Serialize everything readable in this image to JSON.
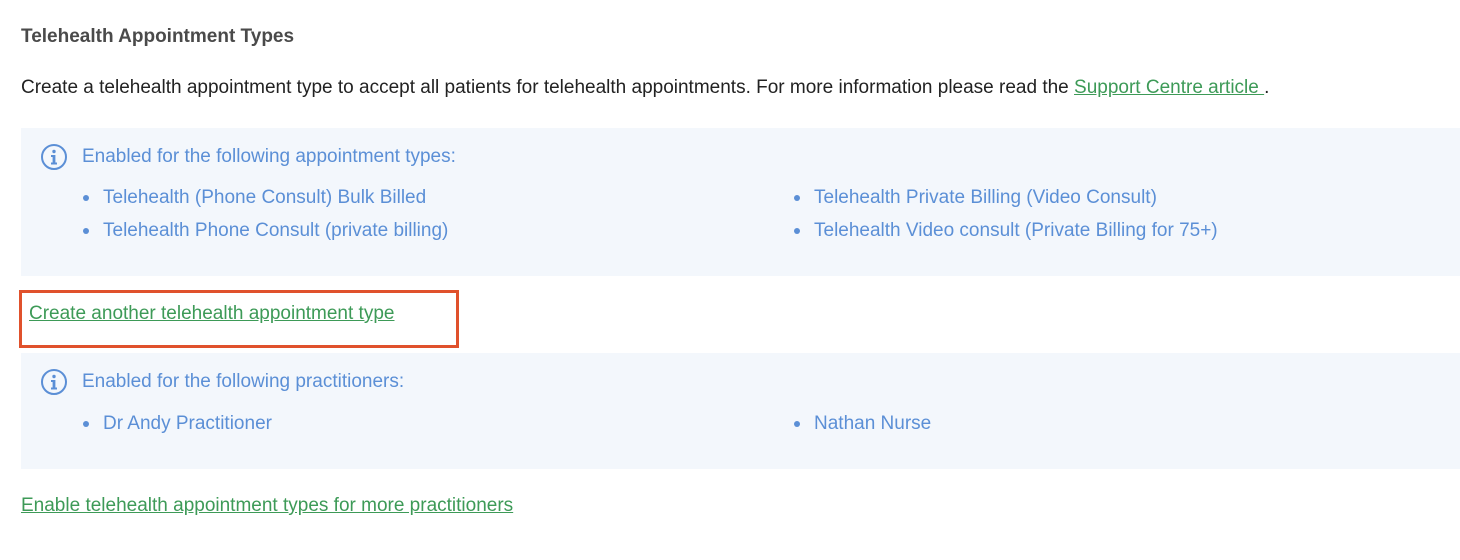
{
  "section": {
    "title": "Telehealth Appointment Types",
    "intro_text": "Create a telehealth appointment type to accept all patients for telehealth appointments. For more information please read the",
    "intro_link": "Support Centre article ",
    "intro_end": "."
  },
  "appointment_types_panel": {
    "icon": "info-icon",
    "heading": "Enabled for the following appointment types:",
    "items": [
      "Telehealth (Phone Consult) Bulk Billed",
      "Telehealth Phone Consult (private billing)",
      "Telehealth Private Billing (Video Consult)",
      "Telehealth Video consult (Private Billing for 75+)"
    ]
  },
  "create_link": "Create another telehealth appointment type",
  "practitioners_panel": {
    "icon": "info-icon",
    "heading": "Enabled for the following practitioners:",
    "items": [
      "Dr Andy Practitioner",
      "Nathan Nurse"
    ]
  },
  "enable_link": "Enable telehealth appointment types for more practitioners",
  "colors": {
    "link": "#3d9a57",
    "info_text": "#5b8fd6",
    "panel_bg": "#f3f7fc",
    "highlight": "#e0512c"
  }
}
